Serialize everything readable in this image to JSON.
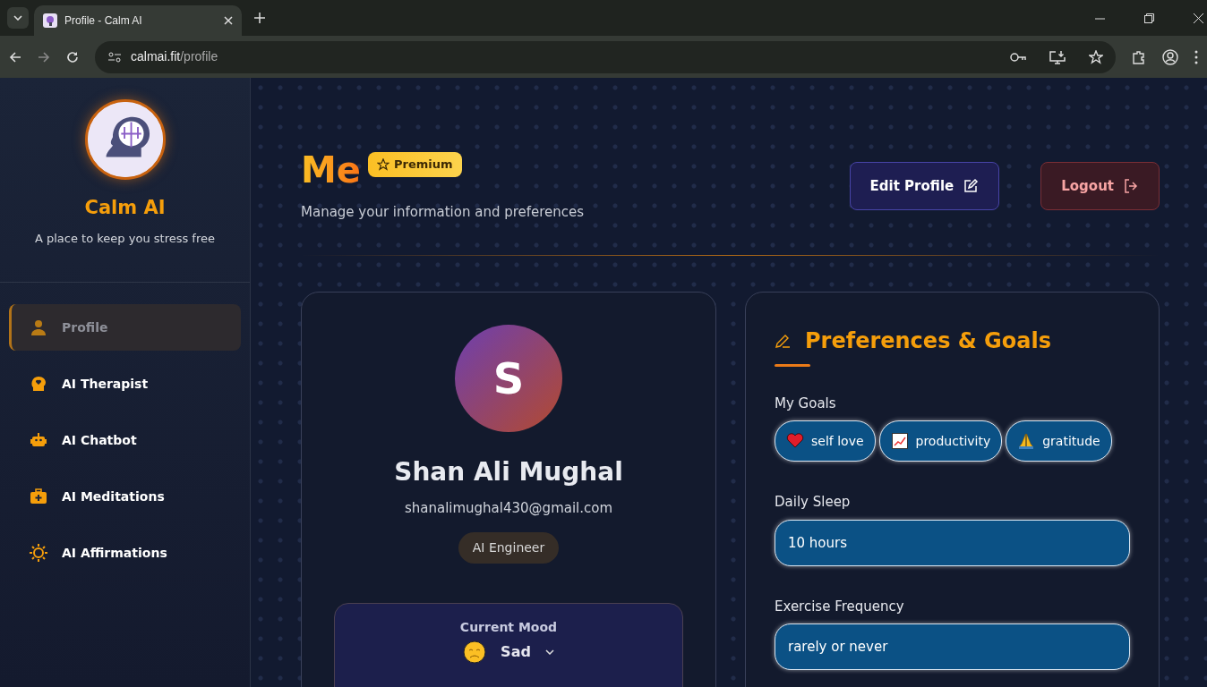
{
  "browser": {
    "tab_title": "Profile - Calm AI",
    "url_host": "calmai.fit",
    "url_path": "/profile"
  },
  "sidebar": {
    "brand": "Calm AI",
    "tagline": "A place to keep you stress free",
    "items": [
      {
        "label": "Profile",
        "kind": "person",
        "selected": true
      },
      {
        "label": "AI Therapist",
        "kind": "head",
        "selected": false
      },
      {
        "label": "AI Chatbot",
        "kind": "robot",
        "selected": false
      },
      {
        "label": "AI Meditations",
        "kind": "kit",
        "selected": false
      },
      {
        "label": "AI Affirmations",
        "kind": "sun",
        "selected": false
      }
    ]
  },
  "header": {
    "title": "Me",
    "badge": "Premium",
    "subtitle": "Manage your information and preferences",
    "buttons": [
      {
        "label": "Edit Profile",
        "kind": "edit"
      },
      {
        "label": "Logout",
        "kind": "logout"
      }
    ]
  },
  "profile": {
    "initial": "S",
    "name": "Shan Ali Mughal",
    "email": "shanalimughal430@gmail.com",
    "role": "AI Engineer",
    "mood": {
      "label": "Current Mood",
      "value": "Sad"
    }
  },
  "preferences": {
    "title": "Preferences & Goals",
    "goals_label": "My Goals",
    "goals": [
      {
        "label": "self love",
        "kind": "heart"
      },
      {
        "label": "productivity",
        "kind": "chart"
      },
      {
        "label": "gratitude",
        "kind": "hands"
      }
    ],
    "fields": [
      {
        "label": "Daily Sleep",
        "value": "10 hours"
      },
      {
        "label": "Exercise Frequency",
        "value": "rarely or never"
      }
    ]
  }
}
